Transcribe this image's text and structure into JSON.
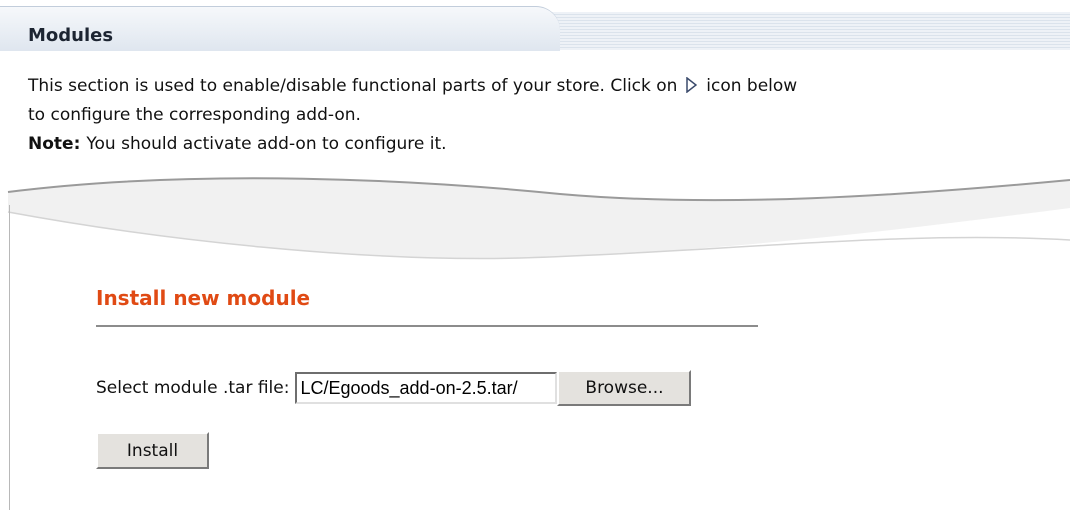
{
  "header": {
    "title": "Modules"
  },
  "intro": {
    "line1_before_icon": "This section is used to enable/disable functional parts of your store. Click on",
    "line1_after_icon": "icon below",
    "line2": "to configure the corresponding add-on.",
    "note_label": "Note:",
    "note_text": "You should activate add-on to configure it.",
    "icon": "play-arrow-icon"
  },
  "install_section": {
    "title": "Install new module",
    "file_label": "Select module .tar file:",
    "file_value": "/LC/Egoods_add-on-2.5.tar",
    "browse_label": "Browse...",
    "install_label": "Install"
  },
  "colors": {
    "section_title": "#e04a14",
    "tab_text": "#1d2532",
    "button_face": "#e4e2de"
  }
}
